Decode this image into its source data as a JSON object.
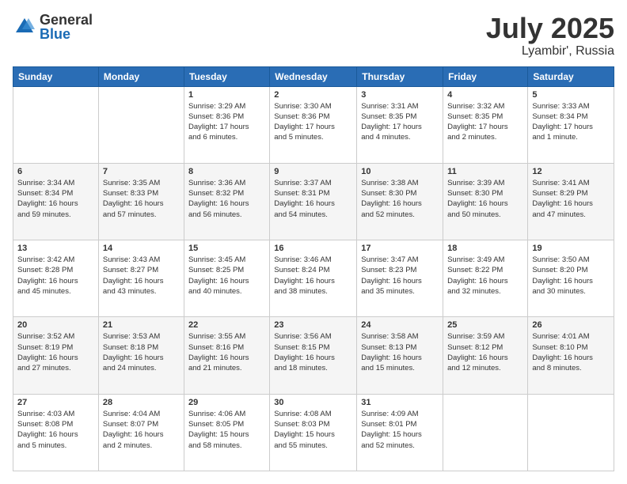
{
  "logo": {
    "general": "General",
    "blue": "Blue"
  },
  "title": {
    "month": "July 2025",
    "location": "Lyambir', Russia"
  },
  "calendar": {
    "headers": [
      "Sunday",
      "Monday",
      "Tuesday",
      "Wednesday",
      "Thursday",
      "Friday",
      "Saturday"
    ],
    "weeks": [
      [
        {
          "day": "",
          "info": ""
        },
        {
          "day": "",
          "info": ""
        },
        {
          "day": "1",
          "info": "Sunrise: 3:29 AM\nSunset: 8:36 PM\nDaylight: 17 hours\nand 6 minutes."
        },
        {
          "day": "2",
          "info": "Sunrise: 3:30 AM\nSunset: 8:36 PM\nDaylight: 17 hours\nand 5 minutes."
        },
        {
          "day": "3",
          "info": "Sunrise: 3:31 AM\nSunset: 8:35 PM\nDaylight: 17 hours\nand 4 minutes."
        },
        {
          "day": "4",
          "info": "Sunrise: 3:32 AM\nSunset: 8:35 PM\nDaylight: 17 hours\nand 2 minutes."
        },
        {
          "day": "5",
          "info": "Sunrise: 3:33 AM\nSunset: 8:34 PM\nDaylight: 17 hours\nand 1 minute."
        }
      ],
      [
        {
          "day": "6",
          "info": "Sunrise: 3:34 AM\nSunset: 8:34 PM\nDaylight: 16 hours\nand 59 minutes."
        },
        {
          "day": "7",
          "info": "Sunrise: 3:35 AM\nSunset: 8:33 PM\nDaylight: 16 hours\nand 57 minutes."
        },
        {
          "day": "8",
          "info": "Sunrise: 3:36 AM\nSunset: 8:32 PM\nDaylight: 16 hours\nand 56 minutes."
        },
        {
          "day": "9",
          "info": "Sunrise: 3:37 AM\nSunset: 8:31 PM\nDaylight: 16 hours\nand 54 minutes."
        },
        {
          "day": "10",
          "info": "Sunrise: 3:38 AM\nSunset: 8:30 PM\nDaylight: 16 hours\nand 52 minutes."
        },
        {
          "day": "11",
          "info": "Sunrise: 3:39 AM\nSunset: 8:30 PM\nDaylight: 16 hours\nand 50 minutes."
        },
        {
          "day": "12",
          "info": "Sunrise: 3:41 AM\nSunset: 8:29 PM\nDaylight: 16 hours\nand 47 minutes."
        }
      ],
      [
        {
          "day": "13",
          "info": "Sunrise: 3:42 AM\nSunset: 8:28 PM\nDaylight: 16 hours\nand 45 minutes."
        },
        {
          "day": "14",
          "info": "Sunrise: 3:43 AM\nSunset: 8:27 PM\nDaylight: 16 hours\nand 43 minutes."
        },
        {
          "day": "15",
          "info": "Sunrise: 3:45 AM\nSunset: 8:25 PM\nDaylight: 16 hours\nand 40 minutes."
        },
        {
          "day": "16",
          "info": "Sunrise: 3:46 AM\nSunset: 8:24 PM\nDaylight: 16 hours\nand 38 minutes."
        },
        {
          "day": "17",
          "info": "Sunrise: 3:47 AM\nSunset: 8:23 PM\nDaylight: 16 hours\nand 35 minutes."
        },
        {
          "day": "18",
          "info": "Sunrise: 3:49 AM\nSunset: 8:22 PM\nDaylight: 16 hours\nand 32 minutes."
        },
        {
          "day": "19",
          "info": "Sunrise: 3:50 AM\nSunset: 8:20 PM\nDaylight: 16 hours\nand 30 minutes."
        }
      ],
      [
        {
          "day": "20",
          "info": "Sunrise: 3:52 AM\nSunset: 8:19 PM\nDaylight: 16 hours\nand 27 minutes."
        },
        {
          "day": "21",
          "info": "Sunrise: 3:53 AM\nSunset: 8:18 PM\nDaylight: 16 hours\nand 24 minutes."
        },
        {
          "day": "22",
          "info": "Sunrise: 3:55 AM\nSunset: 8:16 PM\nDaylight: 16 hours\nand 21 minutes."
        },
        {
          "day": "23",
          "info": "Sunrise: 3:56 AM\nSunset: 8:15 PM\nDaylight: 16 hours\nand 18 minutes."
        },
        {
          "day": "24",
          "info": "Sunrise: 3:58 AM\nSunset: 8:13 PM\nDaylight: 16 hours\nand 15 minutes."
        },
        {
          "day": "25",
          "info": "Sunrise: 3:59 AM\nSunset: 8:12 PM\nDaylight: 16 hours\nand 12 minutes."
        },
        {
          "day": "26",
          "info": "Sunrise: 4:01 AM\nSunset: 8:10 PM\nDaylight: 16 hours\nand 8 minutes."
        }
      ],
      [
        {
          "day": "27",
          "info": "Sunrise: 4:03 AM\nSunset: 8:08 PM\nDaylight: 16 hours\nand 5 minutes."
        },
        {
          "day": "28",
          "info": "Sunrise: 4:04 AM\nSunset: 8:07 PM\nDaylight: 16 hours\nand 2 minutes."
        },
        {
          "day": "29",
          "info": "Sunrise: 4:06 AM\nSunset: 8:05 PM\nDaylight: 15 hours\nand 58 minutes."
        },
        {
          "day": "30",
          "info": "Sunrise: 4:08 AM\nSunset: 8:03 PM\nDaylight: 15 hours\nand 55 minutes."
        },
        {
          "day": "31",
          "info": "Sunrise: 4:09 AM\nSunset: 8:01 PM\nDaylight: 15 hours\nand 52 minutes."
        },
        {
          "day": "",
          "info": ""
        },
        {
          "day": "",
          "info": ""
        }
      ]
    ]
  }
}
